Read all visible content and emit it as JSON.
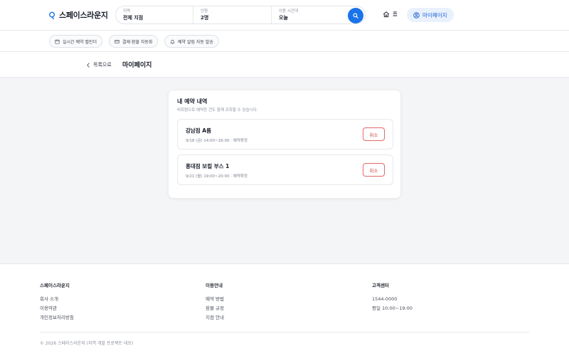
{
  "header": {
    "brand": "스페이스라운지",
    "search": {
      "region": {
        "label": "지역",
        "value": "전체 지점"
      },
      "people": {
        "label": "인원",
        "value": "2명"
      },
      "time": {
        "label": "이용 시간대",
        "value": "오늘"
      }
    },
    "nav": {
      "home": "홈",
      "mypage": "마이페이지"
    },
    "icons": {
      "brand": "location-pin-icon",
      "search": "search-icon",
      "home": "home-icon",
      "user": "user-circle-icon"
    },
    "accent_color": "#1a73e8"
  },
  "features": [
    {
      "label": "실시간 예약 캘린더",
      "icon": "calendar-icon"
    },
    {
      "label": "결제·환불 자동화",
      "icon": "card-icon"
    },
    {
      "label": "예약 알림 자동 발송",
      "icon": "bell-icon"
    }
  ],
  "page_header": {
    "back_label": "목록으로",
    "title": "마이페이지"
  },
  "reservations": {
    "title": "내 예약 내역",
    "subtitle": "비회원으로 예약한 건도 함께 조회할 수 있습니다.",
    "items": [
      {
        "name": "강남점 A룸",
        "meta": "9/18 (금) 14:00~16:00 · 예약확정",
        "action": "취소"
      },
      {
        "name": "홍대점 보컬 부스 1",
        "meta": "9/21 (월) 19:00~20:00 · 예약확정",
        "action": "취소"
      }
    ],
    "cancel_color": "#d24545"
  },
  "footer": {
    "columns": [
      {
        "heading": "스페이스라운지",
        "items": [
          "회사 소개",
          "이용약관",
          "개인정보처리방침"
        ]
      },
      {
        "heading": "이용안내",
        "items": [
          "예약 방법",
          "환불 규정",
          "지점 안내"
        ]
      },
      {
        "heading": "고객센터",
        "items": [
          "1544-0000",
          "평일 10:00~19:00"
        ]
      }
    ],
    "copyright": "© 2026 스페이스라운지 (지역 개발 프로젝트 데모)"
  }
}
